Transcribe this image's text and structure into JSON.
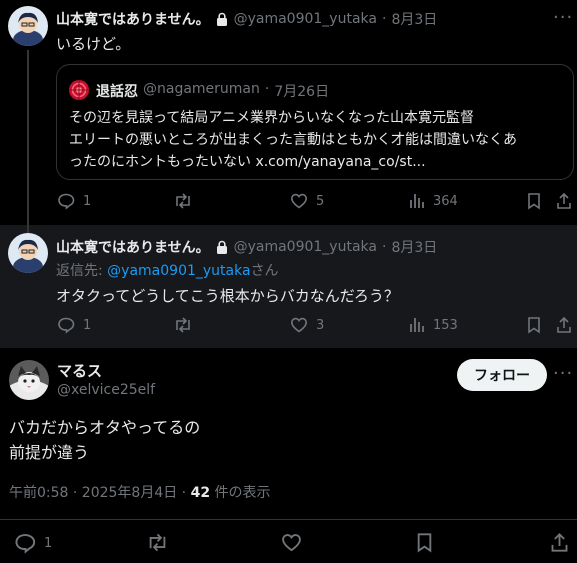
{
  "tweet1": {
    "display_name": "山本寛ではありません。",
    "handle": "@yama0901_yutaka",
    "date": "8月3日",
    "text": "いるけど。",
    "quote": {
      "display_name": "退話忍",
      "handle": "@nagameruman",
      "date": "7月26日",
      "text_line1": "その辺を見誤って結局アニメ業界からいなくなった山本寛元監督",
      "text_line2": "エリートの悪いところが出まくった言動はともかく才能は間違いなくあ",
      "text_line3": "ったのにホントもったいない x.com/yanayana_co/st..."
    },
    "stats": {
      "replies": "1",
      "retweets": "",
      "likes": "5",
      "views": "364"
    }
  },
  "tweet2": {
    "display_name": "山本寛ではありません。",
    "handle": "@yama0901_yutaka",
    "date": "8月3日",
    "reply_prefix": "返信先: ",
    "reply_handle": "@yama0901_yutaka",
    "reply_suffix": "さん",
    "text": "オタクってどうしてこう根本からバカなんだろう？",
    "stats": {
      "replies": "1",
      "retweets": "",
      "likes": "3",
      "views": "153"
    }
  },
  "main": {
    "display_name": "マるス",
    "handle": "@xelvice25elf",
    "follow_label": "フォロー",
    "text_line1": "バカだからオタやってるの",
    "text_line2": "前提が違う",
    "timestamp": "午前0:58 · 2025年8月4日 · ",
    "views_count": "42",
    "views_label": " 件の表示",
    "stats": {
      "replies": "1"
    }
  },
  "colors": {
    "link": "#1d9bf0",
    "muted": "#71767b",
    "bg": "#000000",
    "reply_bg": "#16181c"
  }
}
